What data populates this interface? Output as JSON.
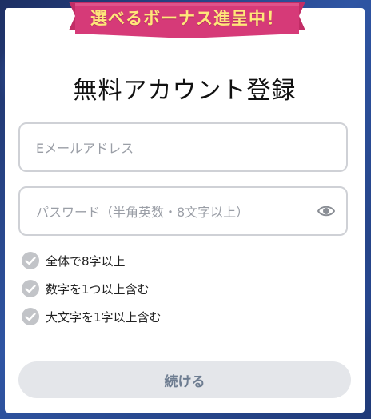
{
  "banner": {
    "text": "選べるボーナス進呈中！"
  },
  "title": "無料アカウント登録",
  "email_field": {
    "placeholder": "Eメールアドレス",
    "value": ""
  },
  "password_field": {
    "placeholder": "パスワード（半角英数・8文字以上）",
    "value": "",
    "toggle_icon": "eye-icon"
  },
  "rules": [
    {
      "label": "全体で8字以上",
      "icon": "check-circle-icon",
      "met": false
    },
    {
      "label": "数字を1つ以上含む",
      "icon": "check-circle-icon",
      "met": false
    },
    {
      "label": "大文字を1字以上含む",
      "icon": "check-circle-icon",
      "met": false
    }
  ],
  "continue_button": {
    "label": "続ける",
    "enabled": false
  },
  "colors": {
    "banner": "#d63a78",
    "banner_text": "#ffe77a",
    "check_gray": "#c2c4c8",
    "button_bg": "#e4e6ea",
    "button_text": "#6e7d91",
    "border": "#cfd1d6"
  }
}
